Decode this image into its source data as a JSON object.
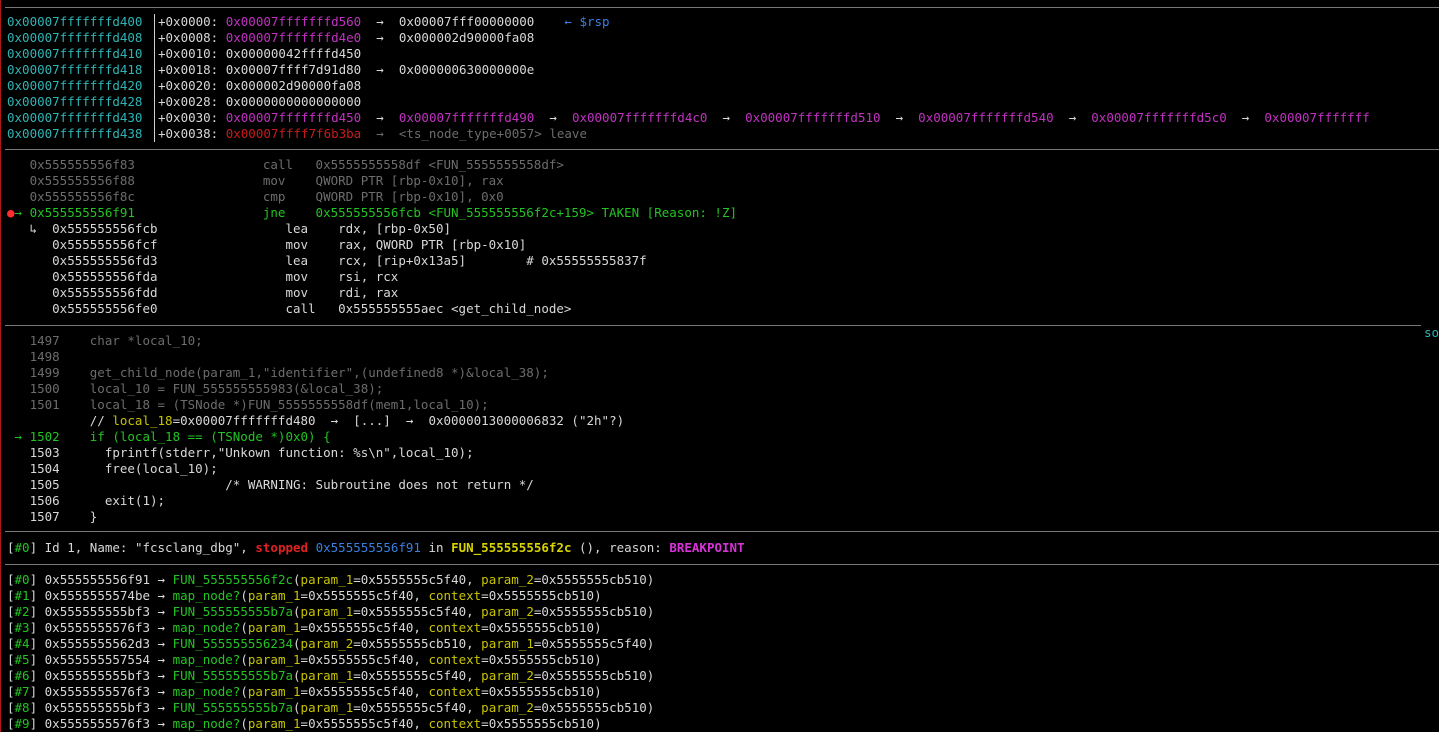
{
  "stack": [
    {
      "addr": "0x00007fffffffd400",
      "off": "+0x0000:",
      "segs": [
        [
          "mag",
          "0x00007fffffffd560"
        ],
        [
          "wht",
          "  →  0x00007fff00000000    "
        ],
        [
          "blue",
          "← $rsp"
        ]
      ]
    },
    {
      "addr": "0x00007fffffffd408",
      "off": "+0x0008:",
      "segs": [
        [
          "mag",
          "0x00007fffffffd4e0"
        ],
        [
          "wht",
          "  →  0x000002d90000fa08"
        ]
      ]
    },
    {
      "addr": "0x00007fffffffd410",
      "off": "+0x0010:",
      "segs": [
        [
          "wht",
          "0x00000042ffffd450"
        ]
      ]
    },
    {
      "addr": "0x00007fffffffd418",
      "off": "+0x0018:",
      "segs": [
        [
          "wht",
          "0x00007ffff7d91d80  →  0x000000630000000e"
        ]
      ]
    },
    {
      "addr": "0x00007fffffffd420",
      "off": "+0x0020:",
      "segs": [
        [
          "wht",
          "0x000002d90000fa08"
        ]
      ]
    },
    {
      "addr": "0x00007fffffffd428",
      "off": "+0x0028:",
      "segs": [
        [
          "wht",
          "0x0000000000000000"
        ]
      ]
    },
    {
      "addr": "0x00007fffffffd430",
      "off": "+0x0030:",
      "segs": [
        [
          "mag",
          "0x00007fffffffd450"
        ],
        [
          "wht",
          "  →  "
        ],
        [
          "mag",
          "0x00007fffffffd490"
        ],
        [
          "wht",
          "  →  "
        ],
        [
          "mag",
          "0x00007fffffffd4c0"
        ],
        [
          "wht",
          "  →  "
        ],
        [
          "mag",
          "0x00007fffffffd510"
        ],
        [
          "wht",
          "  →  "
        ],
        [
          "mag",
          "0x00007fffffffd540"
        ],
        [
          "wht",
          "  →  "
        ],
        [
          "mag",
          "0x00007fffffffd5c0"
        ],
        [
          "wht",
          "  →  "
        ],
        [
          "mag",
          "0x00007fffffff"
        ]
      ]
    },
    {
      "addr": "0x00007fffffffd438",
      "off": "+0x0038:",
      "segs": [
        [
          "dred",
          "0x00007ffff7f6b3ba"
        ],
        [
          "gry",
          "  →  <ts_node_type+0057> leave"
        ]
      ]
    }
  ],
  "code": [
    {
      "segs": [
        [
          "gry",
          "   0x555555556f83                 call   0x5555555558df <FUN_5555555558df>"
        ]
      ]
    },
    {
      "segs": [
        [
          "gry",
          "   0x555555556f88                 mov    QWORD PTR [rbp-0x10], rax"
        ]
      ]
    },
    {
      "segs": [
        [
          "gry",
          "   0x555555556f8c                 cmp    QWORD PTR [rbp-0x10], 0x0"
        ]
      ]
    },
    {
      "segs": [
        [
          "red",
          "●"
        ],
        [
          "grn",
          "→ 0x555555556f91                 jne    0x555555556fcb <FUN_555555556f2c+159> "
        ],
        [
          "grn",
          "TAKEN [Reason: !Z]"
        ]
      ]
    },
    {
      "segs": [
        [
          "wht",
          "   ↳  0x555555556fcb                 lea    rdx, [rbp-0x50]"
        ]
      ]
    },
    {
      "segs": [
        [
          "wht",
          "      0x555555556fcf                 mov    rax, QWORD PTR [rbp-0x10]"
        ]
      ]
    },
    {
      "segs": [
        [
          "wht",
          "      0x555555556fd3                 lea    rcx, [rip+0x13a5]        # 0x55555555837f"
        ]
      ]
    },
    {
      "segs": [
        [
          "wht",
          "      0x555555556fda                 mov    rsi, rcx"
        ]
      ]
    },
    {
      "segs": [
        [
          "wht",
          "      0x555555556fdd                 mov    rdi, rax"
        ]
      ]
    },
    {
      "segs": [
        [
          "wht",
          "      0x555555556fe0                 call   0x555555555aec <get_child_node>"
        ]
      ]
    }
  ],
  "code_section_tag": "so",
  "source": [
    {
      "segs": [
        [
          "gry",
          "   1497    char *local_10;"
        ]
      ]
    },
    {
      "segs": [
        [
          "gry",
          "   1498"
        ]
      ]
    },
    {
      "segs": [
        [
          "gry",
          "   1499    get_child_node(param_1,\"identifier\",(undefined8 *)&local_38);"
        ]
      ]
    },
    {
      "segs": [
        [
          "gry",
          "   1500    local_10 = FUN_555555555983(&local_38);"
        ]
      ]
    },
    {
      "segs": [
        [
          "gry",
          "   1501    local_18 = (TSNode *)FUN_5555555558df(mem1,local_10);"
        ]
      ]
    },
    {
      "segs": [
        [
          "wht",
          "           // "
        ],
        [
          "yel",
          "local_18"
        ],
        [
          "wht",
          "=0x00007fffffffd480  →  [...]  →  0x0000013000006832 (\"2h\"?)"
        ]
      ]
    },
    {
      "segs": [
        [
          "grn",
          " → 1502    if (local_18 == (TSNode *)0x0) {"
        ]
      ]
    },
    {
      "segs": [
        [
          "wht",
          "   1503      fprintf(stderr,\"Unkown function: %s\\n\",local_10);"
        ]
      ]
    },
    {
      "segs": [
        [
          "wht",
          "   1504      free(local_10);"
        ]
      ]
    },
    {
      "segs": [
        [
          "wht",
          "   1505                      /* WARNING: Subroutine does not return */"
        ]
      ]
    },
    {
      "segs": [
        [
          "wht",
          "   1506      exit(1);"
        ]
      ]
    },
    {
      "segs": [
        [
          "wht",
          "   1507    }"
        ]
      ]
    }
  ],
  "thread": {
    "segs": [
      [
        "wht",
        "["
      ],
      [
        "grn",
        "#0"
      ],
      [
        "wht",
        "] Id 1, Name: \"fcsclang_dbg\", "
      ],
      [
        "stop",
        "stopped"
      ],
      [
        "wht",
        " "
      ],
      [
        "blue",
        "0x555555556f91"
      ],
      [
        "wht",
        " in "
      ],
      [
        "ylw-b",
        "FUN_555555556f2c"
      ],
      [
        "wht",
        " (), reason: "
      ],
      [
        "bp",
        "BREAKPOINT"
      ]
    ]
  },
  "trace": [
    {
      "n": "#0",
      "addr": "0x555555556f91",
      "fn": "FUN_555555556f2c",
      "args": [
        [
          "param_1",
          "0x5555555c5f40"
        ],
        [
          "param_2",
          "0x5555555cb510"
        ]
      ]
    },
    {
      "n": "#1",
      "addr": "0x5555555574be",
      "fn": "map_node?",
      "args": [
        [
          "param_1",
          "0x5555555c5f40"
        ],
        [
          "context",
          "0x5555555cb510"
        ]
      ]
    },
    {
      "n": "#2",
      "addr": "0x555555555bf3",
      "fn": "FUN_555555555b7a",
      "args": [
        [
          "param_1",
          "0x5555555c5f40"
        ],
        [
          "param_2",
          "0x5555555cb510"
        ]
      ]
    },
    {
      "n": "#3",
      "addr": "0x5555555576f3",
      "fn": "map_node?",
      "args": [
        [
          "param_1",
          "0x5555555c5f40"
        ],
        [
          "context",
          "0x5555555cb510"
        ]
      ]
    },
    {
      "n": "#4",
      "addr": "0x5555555562d3",
      "fn": "FUN_555555556234",
      "args": [
        [
          "param_2",
          "0x5555555cb510"
        ],
        [
          "param_1",
          "0x5555555c5f40"
        ]
      ]
    },
    {
      "n": "#5",
      "addr": "0x555555557554",
      "fn": "map_node?",
      "args": [
        [
          "param_1",
          "0x5555555c5f40"
        ],
        [
          "context",
          "0x5555555cb510"
        ]
      ]
    },
    {
      "n": "#6",
      "addr": "0x555555555bf3",
      "fn": "FUN_555555555b7a",
      "args": [
        [
          "param_1",
          "0x5555555c5f40"
        ],
        [
          "param_2",
          "0x5555555cb510"
        ]
      ]
    },
    {
      "n": "#7",
      "addr": "0x5555555576f3",
      "fn": "map_node?",
      "args": [
        [
          "param_1",
          "0x5555555c5f40"
        ],
        [
          "context",
          "0x5555555cb510"
        ]
      ]
    },
    {
      "n": "#8",
      "addr": "0x555555555bf3",
      "fn": "FUN_555555555b7a",
      "args": [
        [
          "param_1",
          "0x5555555c5f40"
        ],
        [
          "param_2",
          "0x5555555cb510"
        ]
      ]
    },
    {
      "n": "#9",
      "addr": "0x5555555576f3",
      "fn": "map_node?",
      "args": [
        [
          "param_1",
          "0x5555555c5f40"
        ],
        [
          "context",
          "0x5555555cb510"
        ]
      ]
    }
  ]
}
